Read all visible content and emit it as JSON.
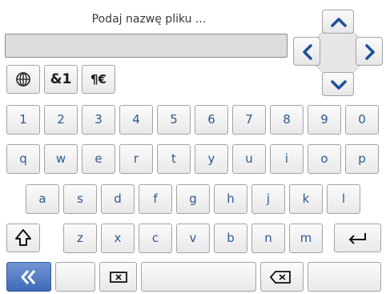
{
  "dialog": {
    "title": "Podaj nazwę pliku ...",
    "filename_value": ""
  },
  "mode_keys": {
    "language": "",
    "symbols": "&1",
    "currency": "¶€"
  },
  "keyboard": {
    "row_numbers": [
      "1",
      "2",
      "3",
      "4",
      "5",
      "6",
      "7",
      "8",
      "9",
      "0"
    ],
    "row_top": [
      "q",
      "w",
      "e",
      "r",
      "t",
      "y",
      "u",
      "i",
      "o",
      "p"
    ],
    "row_home": [
      "a",
      "s",
      "d",
      "f",
      "g",
      "h",
      "j",
      "k",
      "l"
    ],
    "row_bottom": [
      "z",
      "x",
      "c",
      "v",
      "b",
      "n",
      "m"
    ]
  },
  "icons": {
    "globe": "globe-icon",
    "shift": "shift-arrow-icon",
    "enter": "return-icon",
    "back": "double-chevron-left-icon",
    "clear": "clear-field-icon",
    "backspace": "backspace-icon",
    "up": "chevron-up-icon",
    "down": "chevron-down-icon",
    "left": "chevron-left-icon",
    "right": "chevron-right-icon"
  },
  "colors": {
    "key_text": "#2f5a8f",
    "accent": "#4670bf",
    "arrow": "#1f4f9a"
  }
}
